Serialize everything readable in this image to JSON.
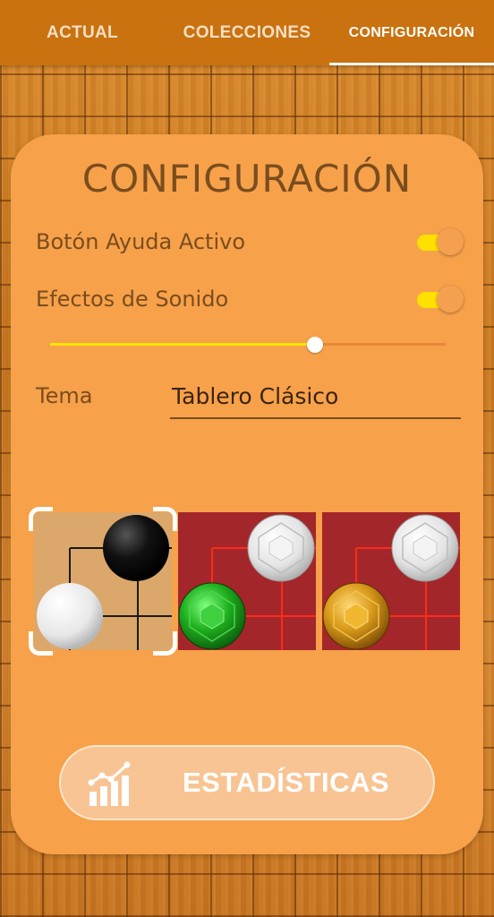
{
  "tabs": [
    {
      "label": "ACTUAL",
      "selected": false
    },
    {
      "label": "COLECCIONES",
      "selected": false
    },
    {
      "label": "CONFIGURACIÓN",
      "selected": true
    }
  ],
  "settings": {
    "title": "CONFIGURACIÓN",
    "help_button": {
      "label": "Botón Ayuda Activo",
      "on": true
    },
    "sound_effects": {
      "label": "Efectos de Sonido",
      "on": true
    },
    "volume": {
      "value": 0.67
    },
    "theme": {
      "label": "Tema",
      "selected": "Tablero Clásico"
    }
  },
  "themes": [
    {
      "name": "classic",
      "board": "#dca76a",
      "lines": "#1a1a1a",
      "stones": [
        "black",
        "white"
      ],
      "selected": true
    },
    {
      "name": "emerald",
      "board": "#a3262a",
      "lines": "#ff2a1a",
      "stones": [
        "diamond",
        "emerald"
      ],
      "selected": false
    },
    {
      "name": "topaz",
      "board": "#a3262a",
      "lines": "#ff2a1a",
      "stones": [
        "diamond",
        "topaz"
      ],
      "selected": false
    }
  ],
  "stats_button": {
    "label": "ESTADÍSTICAS",
    "icon": "bar-chart-trend-icon"
  },
  "colors": {
    "topbar": "#c9720f",
    "panel": "#f7a14a",
    "accent": "#ffe000",
    "text": "#7a4d1e"
  }
}
